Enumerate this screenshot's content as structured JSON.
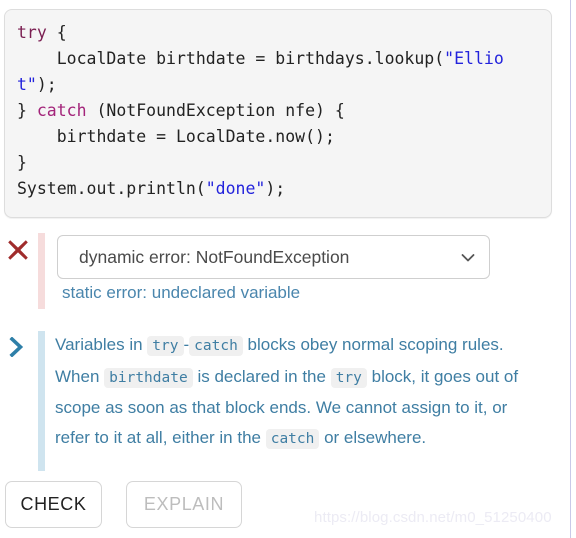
{
  "code_block": {
    "language": "java",
    "lines": [
      {
        "segments": [
          {
            "text": "try",
            "kind": "keyword-try"
          },
          {
            "text": " {",
            "kind": "plain"
          }
        ]
      },
      {
        "segments": [
          {
            "text": "    LocalDate birthdate = birthdays.lookup(",
            "kind": "plain"
          },
          {
            "text": "\"Elliot\"",
            "kind": "string"
          },
          {
            "text": ");",
            "kind": "plain"
          }
        ]
      },
      {
        "segments": [
          {
            "text": "} ",
            "kind": "plain"
          },
          {
            "text": "catch",
            "kind": "keyword-catch"
          },
          {
            "text": " (NotFoundException nfe) {",
            "kind": "plain"
          }
        ]
      },
      {
        "segments": [
          {
            "text": "    birthdate = LocalDate.now();",
            "kind": "plain"
          }
        ]
      },
      {
        "segments": [
          {
            "text": "}",
            "kind": "plain"
          }
        ]
      },
      {
        "segments": [
          {
            "text": "System.out.println(",
            "kind": "plain"
          },
          {
            "text": "\"done\"",
            "kind": "string"
          },
          {
            "text": ");",
            "kind": "plain"
          }
        ]
      }
    ],
    "plain_text": "try {\n    LocalDate birthdate = birthdays.lookup(\"Elliot\");\n} catch (NotFoundException nfe) {\n    birthdate = LocalDate.now();\n}\nSystem.out.println(\"done\");"
  },
  "error_section": {
    "status_icon": "x-mark-icon",
    "accent_color": "#a02c2c",
    "bar_color": "#f6dcdc",
    "select": {
      "value": "dynamic error: NotFoundException",
      "caret_icon": "chevron-down-icon"
    },
    "static_error": "static error: undeclared variable",
    "static_error_color": "#4a86ad"
  },
  "explanation_section": {
    "status_icon": "chevron-right-icon",
    "accent_color": "#2e7fa8",
    "bar_color": "#cfe4ef",
    "parts": [
      {
        "text": "Variables in ",
        "kind": "plain"
      },
      {
        "text": "try",
        "kind": "code"
      },
      {
        "text": "-",
        "kind": "plain"
      },
      {
        "text": "catch",
        "kind": "code"
      },
      {
        "text": " blocks obey normal scoping rules. When ",
        "kind": "plain"
      },
      {
        "text": "birthdate",
        "kind": "code"
      },
      {
        "text": " is declared in the ",
        "kind": "plain"
      },
      {
        "text": "try",
        "kind": "code"
      },
      {
        "text": " block, it goes out of scope as soon as that block ends. We cannot assign to it, or refer to it at all, either in the ",
        "kind": "plain"
      },
      {
        "text": "catch",
        "kind": "code"
      },
      {
        "text": " or elsewhere.",
        "kind": "plain"
      }
    ]
  },
  "buttons": {
    "check_label": "CHECK",
    "explain_label": "EXPLAIN",
    "explain_disabled": true
  },
  "watermark": {
    "text": "https://blog.csdn.net/m0_51250400"
  }
}
